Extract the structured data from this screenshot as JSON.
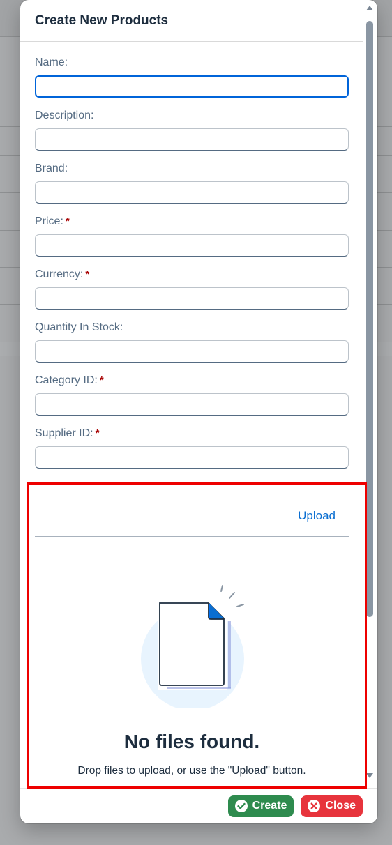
{
  "dialog": {
    "title": "Create New Products"
  },
  "form": {
    "fields": [
      {
        "label": "Name:",
        "required": false,
        "value": "",
        "focused": true
      },
      {
        "label": "Description:",
        "required": false,
        "value": ""
      },
      {
        "label": "Brand:",
        "required": false,
        "value": ""
      },
      {
        "label": "Price:",
        "required": true,
        "value": ""
      },
      {
        "label": "Currency:",
        "required": true,
        "value": ""
      },
      {
        "label": "Quantity In Stock:",
        "required": false,
        "value": ""
      },
      {
        "label": "Category ID:",
        "required": true,
        "value": ""
      },
      {
        "label": "Supplier ID:",
        "required": true,
        "value": ""
      }
    ],
    "required_marker": "*"
  },
  "uploader": {
    "upload_label": "Upload",
    "empty_title": "No files found.",
    "empty_description": "Drop files to upload, or use the \"Upload\" button.",
    "illustration_icon": "no-files-document-icon"
  },
  "footer": {
    "create_label": "Create",
    "close_label": "Close",
    "create_icon": "check-circle-icon",
    "close_icon": "close-circle-icon"
  },
  "colors": {
    "accent": "#0064d9",
    "link": "#0a6ed1",
    "create_button": "#2e8b4e",
    "close_button": "#e7343c",
    "required": "#aa0808",
    "highlight_border": "#ee0000"
  }
}
